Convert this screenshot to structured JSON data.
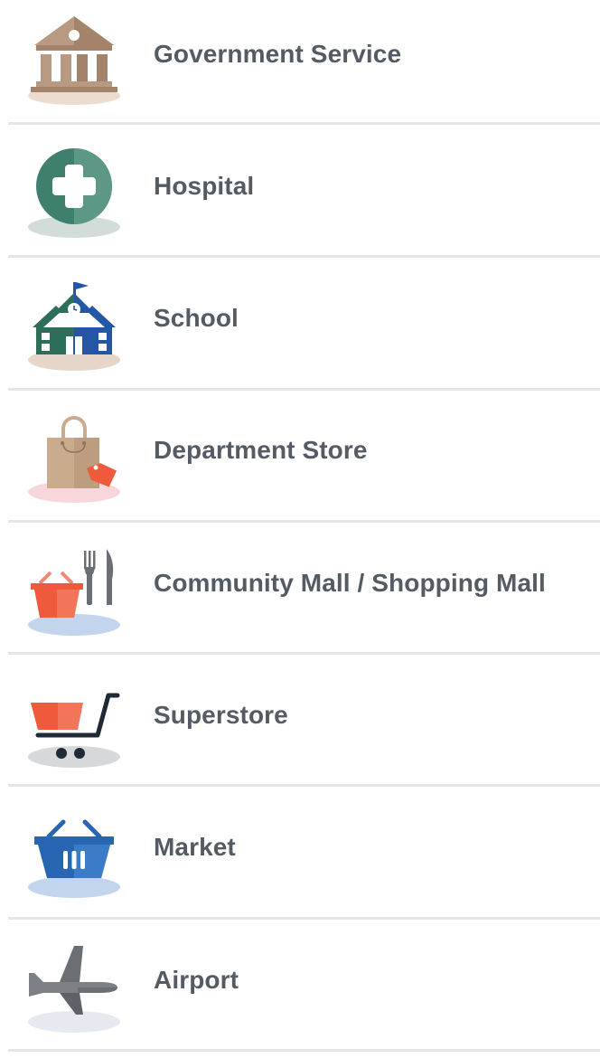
{
  "places": [
    {
      "label": "Government Service",
      "icon": "government-building-icon"
    },
    {
      "label": "Hospital",
      "icon": "hospital-cross-icon"
    },
    {
      "label": "School",
      "icon": "school-building-icon"
    },
    {
      "label": "Department Store",
      "icon": "shopping-bag-icon"
    },
    {
      "label": "Community Mall / Shopping Mall",
      "icon": "basket-cutlery-icon"
    },
    {
      "label": "Superstore",
      "icon": "shopping-cart-icon"
    },
    {
      "label": "Market",
      "icon": "market-basket-icon"
    },
    {
      "label": "Airport",
      "icon": "airplane-icon"
    }
  ],
  "colors": {
    "label_text": "#555b63",
    "divider": "#e4e6e9",
    "government": "#b89a82",
    "hospital": "#3f7f6e",
    "school_green": "#2d6e5a",
    "school_blue": "#2456a6",
    "store_bag": "#c9ab8e",
    "store_tag": "#ef5a3c",
    "mall_basket": "#ef5a3c",
    "cart": "#1f2a36",
    "market": "#2866b3",
    "airplane": "#6b6f74"
  }
}
